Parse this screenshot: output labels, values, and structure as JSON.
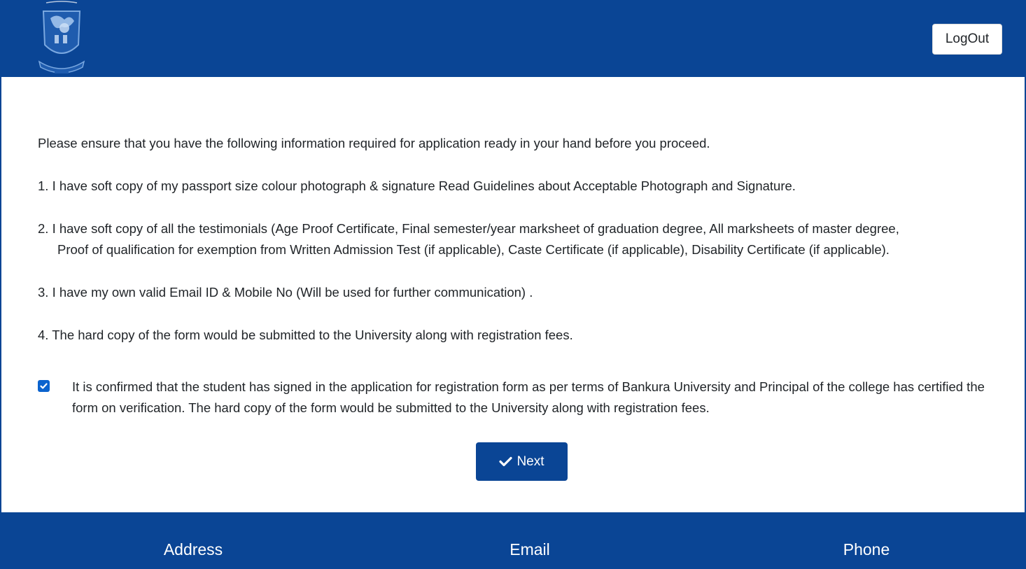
{
  "header": {
    "logout_label": "LogOut"
  },
  "content": {
    "intro": "Please ensure that you have the following information required for application ready in your hand before you proceed.",
    "items": [
      {
        "line1": "1. I have soft copy of my passport size colour photograph & signature Read Guidelines about Acceptable Photograph and Signature.",
        "line2": ""
      },
      {
        "line1": "2. I have soft copy of all the testimonials (Age Proof Certificate, Final semester/year marksheet of graduation degree, All marksheets of master degree,",
        "line2": "Proof of qualification for exemption from Written Admission   Test (if applicable), Caste Certificate (if applicable), Disability Certificate (if applicable)."
      },
      {
        "line1": "3. I have my own valid Email ID & Mobile No (Will be used for further communication) .",
        "line2": ""
      },
      {
        "line1": "4. The hard copy of the form would be submitted to the University along with registration fees.",
        "line2": ""
      }
    ],
    "confirm_text": "It is confirmed that the student has signed in the application for registration form as per terms of Bankura University and Principal of the college has certified the form on verification. The hard copy of the form would be submitted to the University along with registration fees.",
    "confirm_checked": true,
    "next_label": "Next"
  },
  "footer": {
    "address_label": "Address",
    "email_label": "Email",
    "phone_label": "Phone"
  },
  "colors": {
    "brand": "#0a4595",
    "checkbox": "#0b63ce"
  },
  "icons": {
    "logo": "university-emblem-icon",
    "next": "check-icon"
  }
}
